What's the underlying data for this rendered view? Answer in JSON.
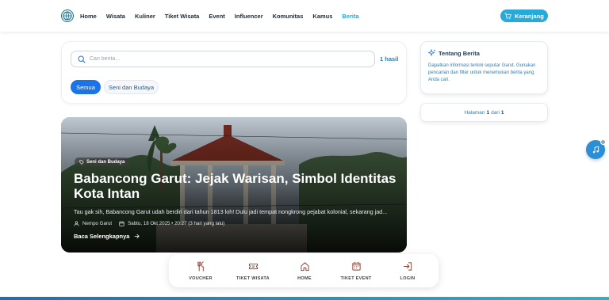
{
  "nav": {
    "links": [
      {
        "label": "Home"
      },
      {
        "label": "Wisata"
      },
      {
        "label": "Kuliner"
      },
      {
        "label": "Tiket Wisata"
      },
      {
        "label": "Event"
      },
      {
        "label": "Influencer"
      },
      {
        "label": "Komunitas"
      },
      {
        "label": "Kamus"
      },
      {
        "label": "Berita"
      }
    ],
    "active": "Berita",
    "cart_label": "Keranjang",
    "accent_color": "#28a9d8"
  },
  "search": {
    "placeholder": "Cari berita...",
    "value": "",
    "result_count": "1 hasil"
  },
  "filters": [
    {
      "label": "Semua",
      "selected": true
    },
    {
      "label": "Seni dan Budaya",
      "selected": false
    }
  ],
  "featured": {
    "category": "Seni dan Budaya",
    "title": "Babancong Garut: Jejak Warisan, Simbol Identitas Kota Intan",
    "excerpt": "Tau gak sih, Babancong Garut udah berdiri dari tahun 1813 loh! Dulu jadi tempat nongkrong pejabat kolonial, sekarang jad...",
    "author": "Nempo Garut",
    "date": "Sabtu, 18 Okt 2025 • 20:27 (3 hari yang lalu)",
    "read_more": "Baca Selengkapnya"
  },
  "sidebar": {
    "about_title": "Tentang Berita",
    "about_text": "Dapatkan informasi terkini seputar Garut. Gunakan pencarian dan filter untuk menemukan berita yang Anda cari.",
    "page_prefix": "Halaman",
    "page_current": "1",
    "page_of": "dari",
    "page_total": "1"
  },
  "bottom_nav": [
    {
      "label": "VOUCHER",
      "icon": "utensils-icon"
    },
    {
      "label": "TIKET WISATA",
      "icon": "ticket-icon"
    },
    {
      "label": "HOME",
      "icon": "home-icon"
    },
    {
      "label": "TIKET EVENT",
      "icon": "calendar-icon"
    },
    {
      "label": "LOGIN",
      "icon": "login-icon"
    }
  ]
}
